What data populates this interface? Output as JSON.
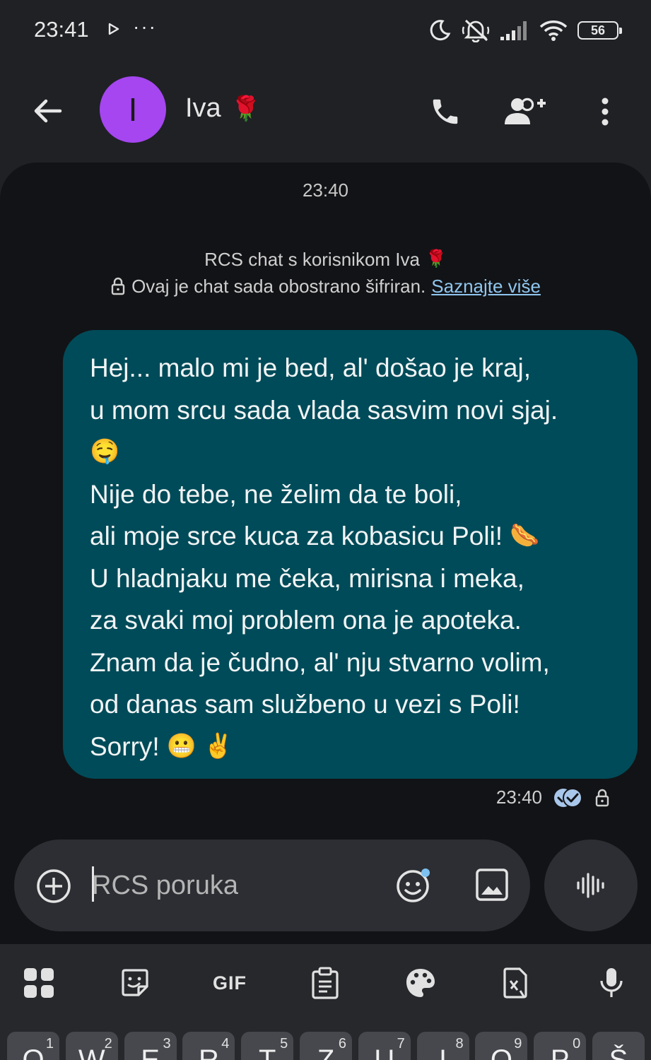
{
  "status_bar": {
    "time": "23:41",
    "overflow": "···",
    "battery": "56",
    "icons": [
      "play-icon",
      "moon-icon",
      "mute-icon",
      "signal-icon",
      "wifi-icon",
      "battery-icon"
    ]
  },
  "header": {
    "avatar_letter": "I",
    "avatar_color": "#a546f0",
    "contact_name": "Iva",
    "name_emoji": "🌹",
    "icons": [
      "back-arrow-icon",
      "phone-icon",
      "add-person-icon",
      "more-vert-icon"
    ]
  },
  "conversation": {
    "date_stamp": "23:40",
    "rcs_title": "RCS chat s korisnikom Iva",
    "rcs_title_emoji": "🌹",
    "encryption_text": "Ovaj je chat sada obostrano šifriran.",
    "learn_more": "Saznajte više",
    "message": {
      "lines": [
        {
          "text": "Hej... malo mi je bed, al' došao je kraj,",
          "emoji": ""
        },
        {
          "text": "u mom srcu sada vlada sasvim novi sjaj.",
          "emoji": ""
        },
        {
          "text": "",
          "emoji": "🤤"
        },
        {
          "text": "Nije do tebe, ne želim da te boli,",
          "emoji": ""
        },
        {
          "text": "ali moje srce kuca za kobasicu Poli!",
          "emoji": "🌭"
        },
        {
          "text": "U hladnjaku me čeka, mirisna i meka,",
          "emoji": ""
        },
        {
          "text": "za svaki moj problem ona je apoteka.",
          "emoji": ""
        },
        {
          "text": "Znam da je čudno, al' nju stvarno volim,",
          "emoji": ""
        },
        {
          "text": "od danas sam službeno u vezi s Poli!",
          "emoji": ""
        },
        {
          "text": "Sorry!",
          "emoji": "😬 ✌️"
        }
      ],
      "time": "23:40",
      "bubble_color": "#004b59"
    }
  },
  "composer": {
    "placeholder": "RCS poruka",
    "value": ""
  },
  "keyboard": {
    "toolbar": {
      "gif_label": "GIF",
      "icons": [
        "apps-grid-icon",
        "sticker-icon",
        "gif-icon",
        "clipboard-icon",
        "palette-icon",
        "translate-icon",
        "mic-icon"
      ]
    },
    "keys": [
      {
        "letter": "Q",
        "hint": "1"
      },
      {
        "letter": "W",
        "hint": "2"
      },
      {
        "letter": "E",
        "hint": "3"
      },
      {
        "letter": "R",
        "hint": "4"
      },
      {
        "letter": "T",
        "hint": "5"
      },
      {
        "letter": "Z",
        "hint": "6"
      },
      {
        "letter": "U",
        "hint": "7"
      },
      {
        "letter": "I",
        "hint": "8"
      },
      {
        "letter": "O",
        "hint": "9"
      },
      {
        "letter": "P",
        "hint": "0"
      },
      {
        "letter": "Š",
        "hint": ""
      }
    ]
  }
}
